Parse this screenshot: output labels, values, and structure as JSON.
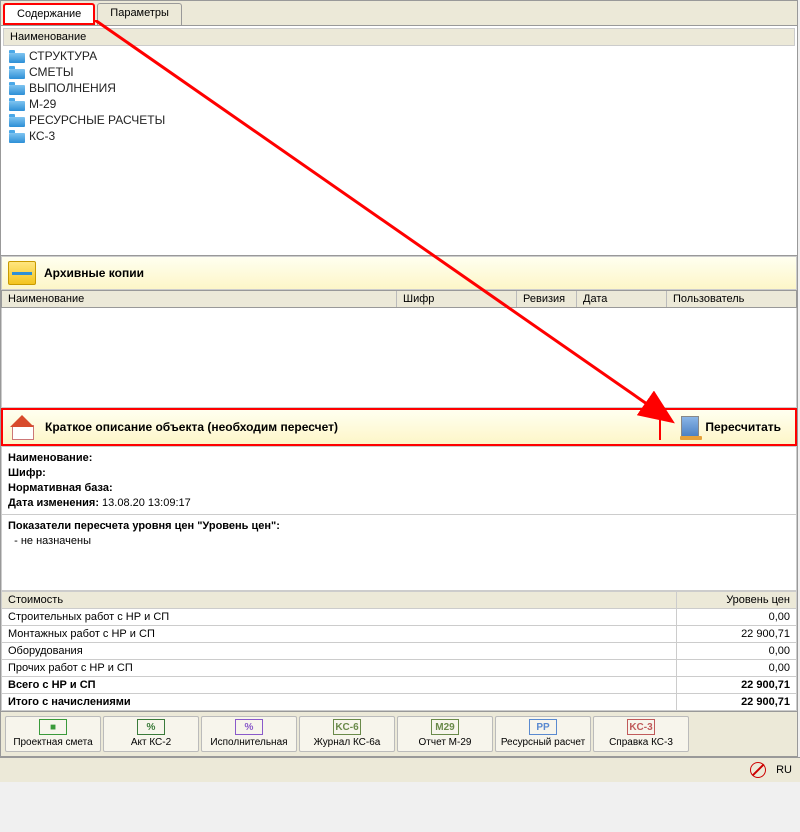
{
  "tabs": {
    "content": "Содержание",
    "params": "Параметры"
  },
  "tree": {
    "header": "Наименование",
    "items": [
      {
        "label": "СТРУКТУРА"
      },
      {
        "label": "СМЕТЫ"
      },
      {
        "label": "ВЫПОЛНЕНИЯ"
      },
      {
        "label": "М-29"
      },
      {
        "label": "РЕСУРСНЫЕ РАСЧЕТЫ"
      },
      {
        "label": "КС-3"
      }
    ]
  },
  "archive": {
    "title": "Архивные копии",
    "cols": {
      "name": "Наименование",
      "code": "Шифр",
      "rev": "Ревизия",
      "date": "Дата",
      "user": "Пользователь"
    }
  },
  "desc": {
    "title": "Краткое описание объекта (необходим пересчет)",
    "recalc": "Пересчитать",
    "fields": {
      "name_lbl": "Наименование:",
      "code_lbl": "Шифр:",
      "base_lbl": "Нормативная база:",
      "date_lbl": "Дата изменения:",
      "date_val": "13.08.20 13:09:17",
      "indicators_lbl": "Показатели пересчета уровня цен \"Уровень цен\":",
      "indicators_val": "- не назначены"
    }
  },
  "costs": {
    "hdr_cost": "Стоимость",
    "hdr_level": "Уровень цен",
    "rows": [
      {
        "label": "Строительных работ с НР и СП",
        "value": "0,00",
        "bold": false
      },
      {
        "label": "Монтажных работ с НР и СП",
        "value": "22 900,71",
        "bold": false
      },
      {
        "label": "Оборудования",
        "value": "0,00",
        "bold": false
      },
      {
        "label": "Прочих работ с НР и СП",
        "value": "0,00",
        "bold": false
      },
      {
        "label": "Всего с НР и СП",
        "value": "22 900,71",
        "bold": true
      },
      {
        "label": "Итого с начислениями",
        "value": "22 900,71",
        "bold": true
      }
    ]
  },
  "toolbar": [
    {
      "icon_text": "■",
      "icon_color": "#3a9a3a",
      "label": "Проектная смета"
    },
    {
      "icon_text": "%",
      "icon_color": "#3a7a3a",
      "label": "Акт КС-2"
    },
    {
      "icon_text": "%",
      "icon_color": "#8a5aca",
      "label": "Исполнительная"
    },
    {
      "icon_text": "KC-6",
      "icon_color": "#6a8a4a",
      "label": "Журнал КС-6а"
    },
    {
      "icon_text": "M29",
      "icon_color": "#6a8a4a",
      "label": "Отчет М-29"
    },
    {
      "icon_text": "PP",
      "icon_color": "#5a8ad0",
      "label": "Ресурсный расчет"
    },
    {
      "icon_text": "KC-3",
      "icon_color": "#c05a5a",
      "label": "Справка КС-3"
    }
  ],
  "status": {
    "lang": "RU"
  }
}
